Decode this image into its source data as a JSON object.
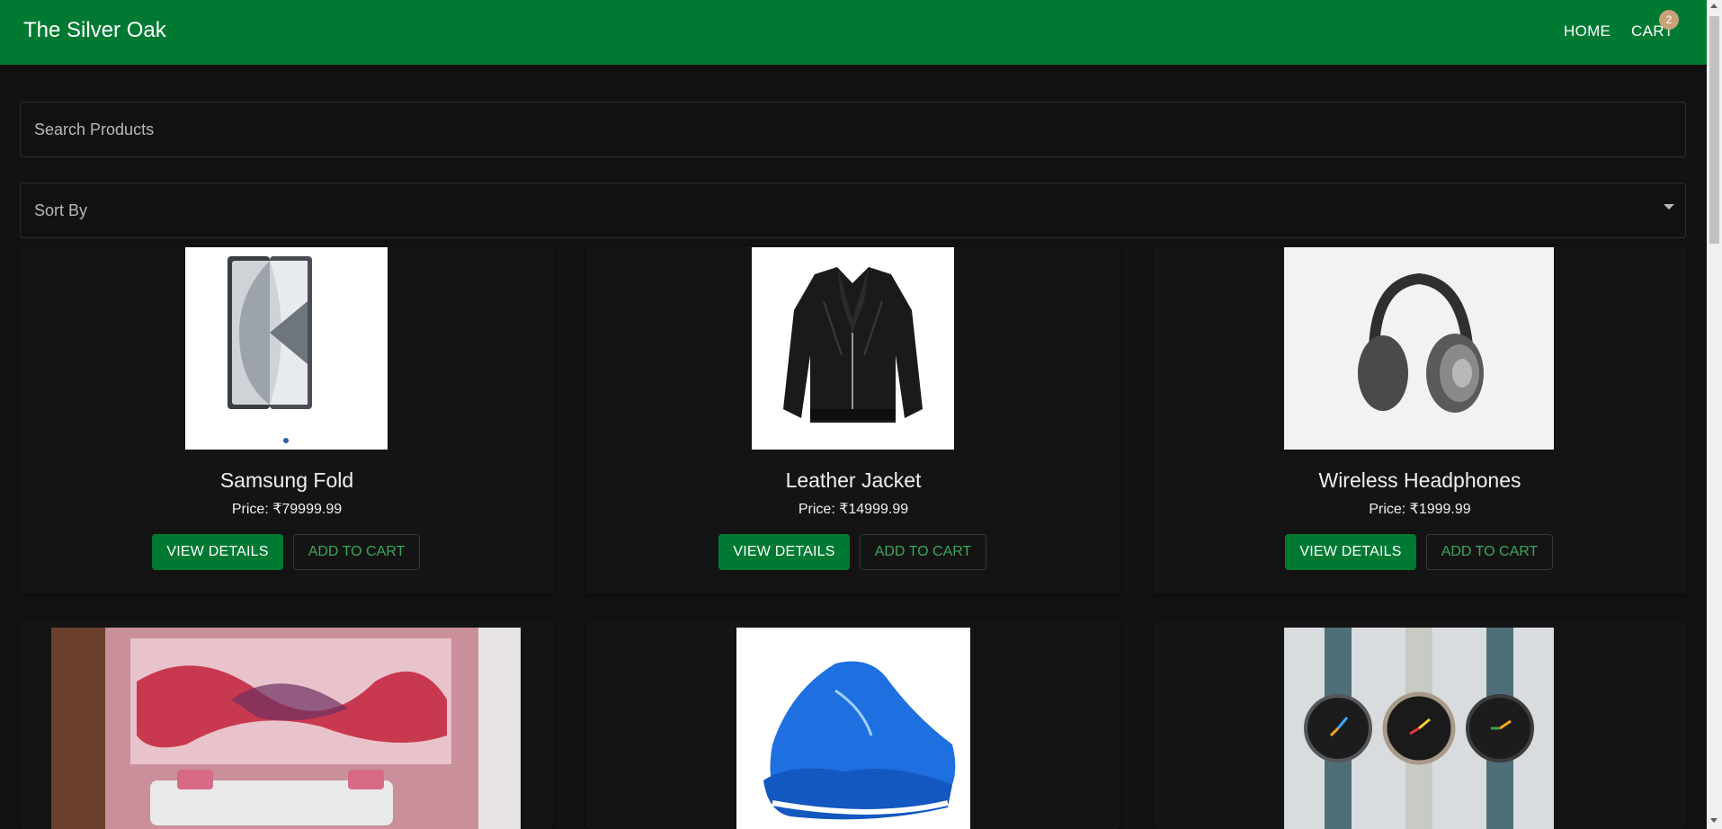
{
  "appbar": {
    "brand": "The Silver Oak",
    "nav": {
      "home": "HOME",
      "cart": "CART",
      "cart_count": "2"
    }
  },
  "search": {
    "placeholder": "Search Products"
  },
  "sort": {
    "label": "Sort By"
  },
  "products": [
    {
      "name": "Samsung Fold",
      "price": "Price: ₹79999.99",
      "view_label": "VIEW DETAILS",
      "add_label": "ADD TO CART"
    },
    {
      "name": "Leather Jacket",
      "price": "Price: ₹14999.99",
      "view_label": "VIEW DETAILS",
      "add_label": "ADD TO CART"
    },
    {
      "name": "Wireless Headphones",
      "price": "Price: ₹1999.99",
      "view_label": "VIEW DETAILS",
      "add_label": "ADD TO CART"
    }
  ],
  "colors": {
    "primary": "#007a33",
    "background": "#121212",
    "accent_text": "#3ba75a",
    "badge": "#c9a27a"
  }
}
